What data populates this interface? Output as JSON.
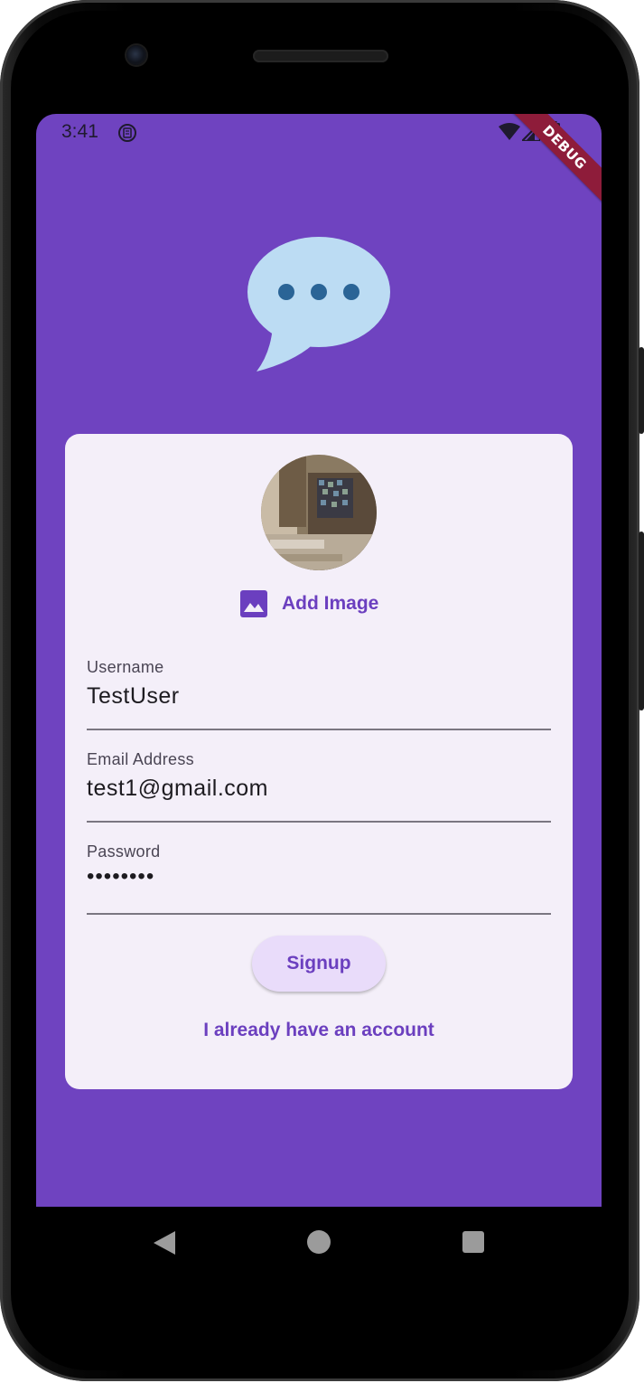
{
  "status_bar": {
    "time": "3:41",
    "icons": [
      "sim-icon",
      "wifi-icon",
      "signal-icon",
      "battery-icon"
    ]
  },
  "debug_banner": "DEBUG",
  "logo": {
    "icon": "chat-bubble-icon",
    "bubble_color": "#bcdcf3",
    "dots_color": "#2a6496"
  },
  "signup_card": {
    "avatar": "avatar-image",
    "add_image": {
      "icon": "image-icon",
      "label": "Add Image"
    },
    "fields": {
      "username": {
        "label": "Username",
        "value": "TestUser"
      },
      "email": {
        "label": "Email Address",
        "value": "test1@gmail.com"
      },
      "password": {
        "label": "Password",
        "value": "••••••••"
      }
    },
    "signup_label": "Signup",
    "login_link_label": "I already have an account"
  },
  "nav_bar": {
    "icons": [
      "back-icon",
      "home-icon",
      "recents-icon"
    ]
  },
  "colors": {
    "background": "#6f43c0",
    "card": "#f4eff9",
    "accent": "#6b3fbf",
    "button_fill": "#e9dcfa",
    "debug_banner": "#8e1c3a"
  }
}
